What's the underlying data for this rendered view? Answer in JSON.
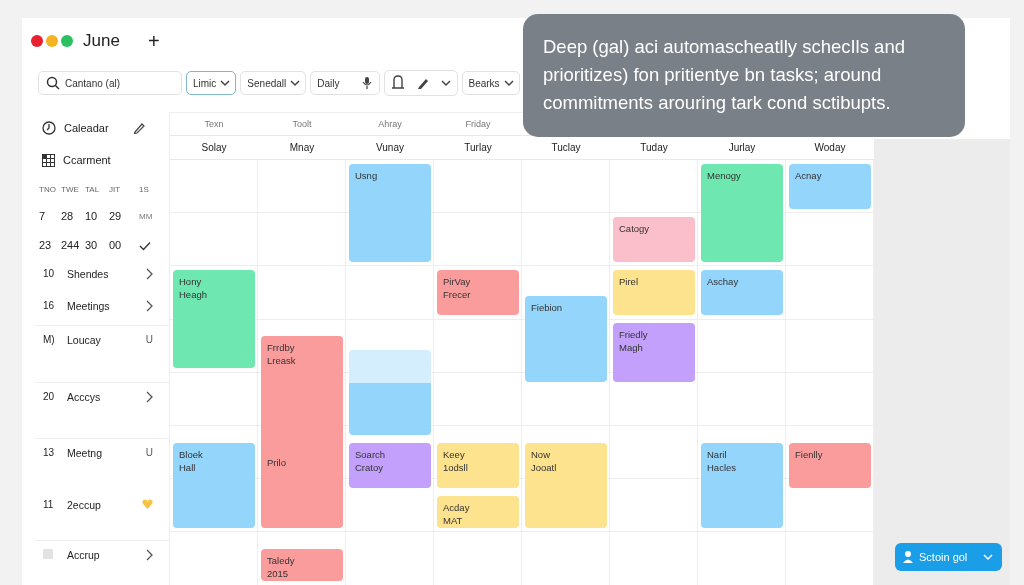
{
  "window": {
    "title": "June",
    "add_label": "+"
  },
  "toolbar": {
    "search": {
      "value": "Cantano (al)"
    },
    "controls": [
      {
        "kind": "dropdown",
        "label": "Limic",
        "selected": true
      },
      {
        "kind": "dropdown",
        "label": "Senedall",
        "selected": false
      },
      {
        "kind": "mic",
        "label": "Daily",
        "selected": false
      },
      {
        "kind": "icons",
        "selected": false
      },
      {
        "kind": "dropdown",
        "label": "Bearks",
        "selected": false
      }
    ]
  },
  "sidebar": {
    "items": [
      {
        "label": "Caleadar",
        "kind": "clock"
      },
      {
        "label": "Ccarment",
        "kind": "grid"
      }
    ],
    "mini_calendar": {
      "header": [
        "TNO",
        "TWE",
        "TAL",
        "JIT",
        "1S"
      ],
      "rows": [
        [
          "7",
          "28",
          "10",
          "29",
          "MM"
        ],
        [
          "23",
          "244",
          "30",
          "00"
        ]
      ]
    },
    "list": [
      {
        "number": "10",
        "label": "Shendes",
        "kind": "chevron"
      },
      {
        "number": "16",
        "label": "Meetings",
        "kind": "chevron"
      },
      {
        "number": "M)",
        "label": "Loucay",
        "kind": "text",
        "trail_text": "U"
      },
      {
        "number": "20",
        "label": "Acccys",
        "kind": "chevron"
      },
      {
        "number": "13",
        "label": "Meetng",
        "kind": "text",
        "trail_text": "U"
      },
      {
        "number": "11",
        "label": "2eccup",
        "kind": "heart"
      },
      {
        "label": "Accrup",
        "kind": "chevron"
      }
    ]
  },
  "calendar": {
    "header_top": [
      "Texn",
      "Toolt",
      "Ahray",
      "Friday"
    ],
    "days": [
      {
        "name": "Solay",
        "events": [
          {
            "kind": "event",
            "lines": [
              "Hony",
              "Heagh"
            ],
            "color": "#6ee7b0"
          },
          {
            "kind": "event",
            "lines": [
              "Bloek",
              "Hall"
            ],
            "color": "#93d5fb"
          }
        ]
      },
      {
        "name": "Mnay",
        "events": [
          {
            "kind": "event",
            "lines": [
              "Frrdby",
              "Lreask"
            ],
            "note": "Prilo",
            "color": "#fb9c9c"
          },
          {
            "kind": "event",
            "lines": [
              "Taledy",
              "2015"
            ],
            "color": "#fb9c9c"
          }
        ]
      },
      {
        "name": "Vunay",
        "events": [
          {
            "kind": "event",
            "lines": [
              "Usng"
            ],
            "color": "#93d5fb"
          },
          {
            "kind": "blank",
            "color": "#93d5fb"
          },
          {
            "kind": "event",
            "lines": [
              "Soarch",
              "Cratoy"
            ],
            "color": "#c3a0fb"
          }
        ]
      },
      {
        "name": "Turlay",
        "events": [
          {
            "kind": "event",
            "lines": [
              "PirVay",
              "Frecer"
            ],
            "color": "#fb9c9c"
          },
          {
            "kind": "event",
            "lines": [
              "Keey",
              "1odsll"
            ],
            "color": "#fde38d"
          },
          {
            "kind": "event",
            "lines": [
              "Acday",
              "MAT"
            ],
            "color": "#fde38d"
          }
        ]
      },
      {
        "name": "Tuclay",
        "events": [
          {
            "kind": "event",
            "lines": [
              "Fiebion"
            ],
            "color": "#93d5fb"
          },
          {
            "kind": "event",
            "lines": [
              "Now",
              "Jooatl"
            ],
            "color": "#fde38d"
          }
        ]
      },
      {
        "name": "Tuday",
        "events": [
          {
            "kind": "event",
            "lines": [
              "Catogy"
            ],
            "color": "#fbbfcc"
          },
          {
            "kind": "event",
            "lines": [
              "Pirel"
            ],
            "color": "#fde38d"
          },
          {
            "kind": "event",
            "lines": [
              "Friedly",
              "Magh"
            ],
            "color": "#c3a0fb"
          }
        ]
      },
      {
        "name": "Jurlay",
        "events": [
          {
            "kind": "event",
            "lines": [
              "Menogy"
            ],
            "color": "#6ee7b0"
          },
          {
            "kind": "event",
            "lines": [
              "Aschay"
            ],
            "color": "#93d5fb"
          },
          {
            "kind": "event",
            "lines": [
              "Naril",
              "Hacles"
            ],
            "color": "#93d5fb"
          }
        ]
      },
      {
        "name": "Woday",
        "events": [
          {
            "kind": "event",
            "lines": [
              "Acnay"
            ],
            "color": "#93d5fb"
          },
          {
            "kind": "event",
            "lines": [
              "Fienlly"
            ],
            "color": "#fb9c9c"
          }
        ]
      }
    ]
  },
  "tooltip": {
    "text": "Deep (gal) aci automascheatlly schecIls and prioritizes) fon pritientye bn tasks; around commitments arouring tark cond sctibupts."
  },
  "action_button": {
    "label": "Sctoin gol"
  }
}
